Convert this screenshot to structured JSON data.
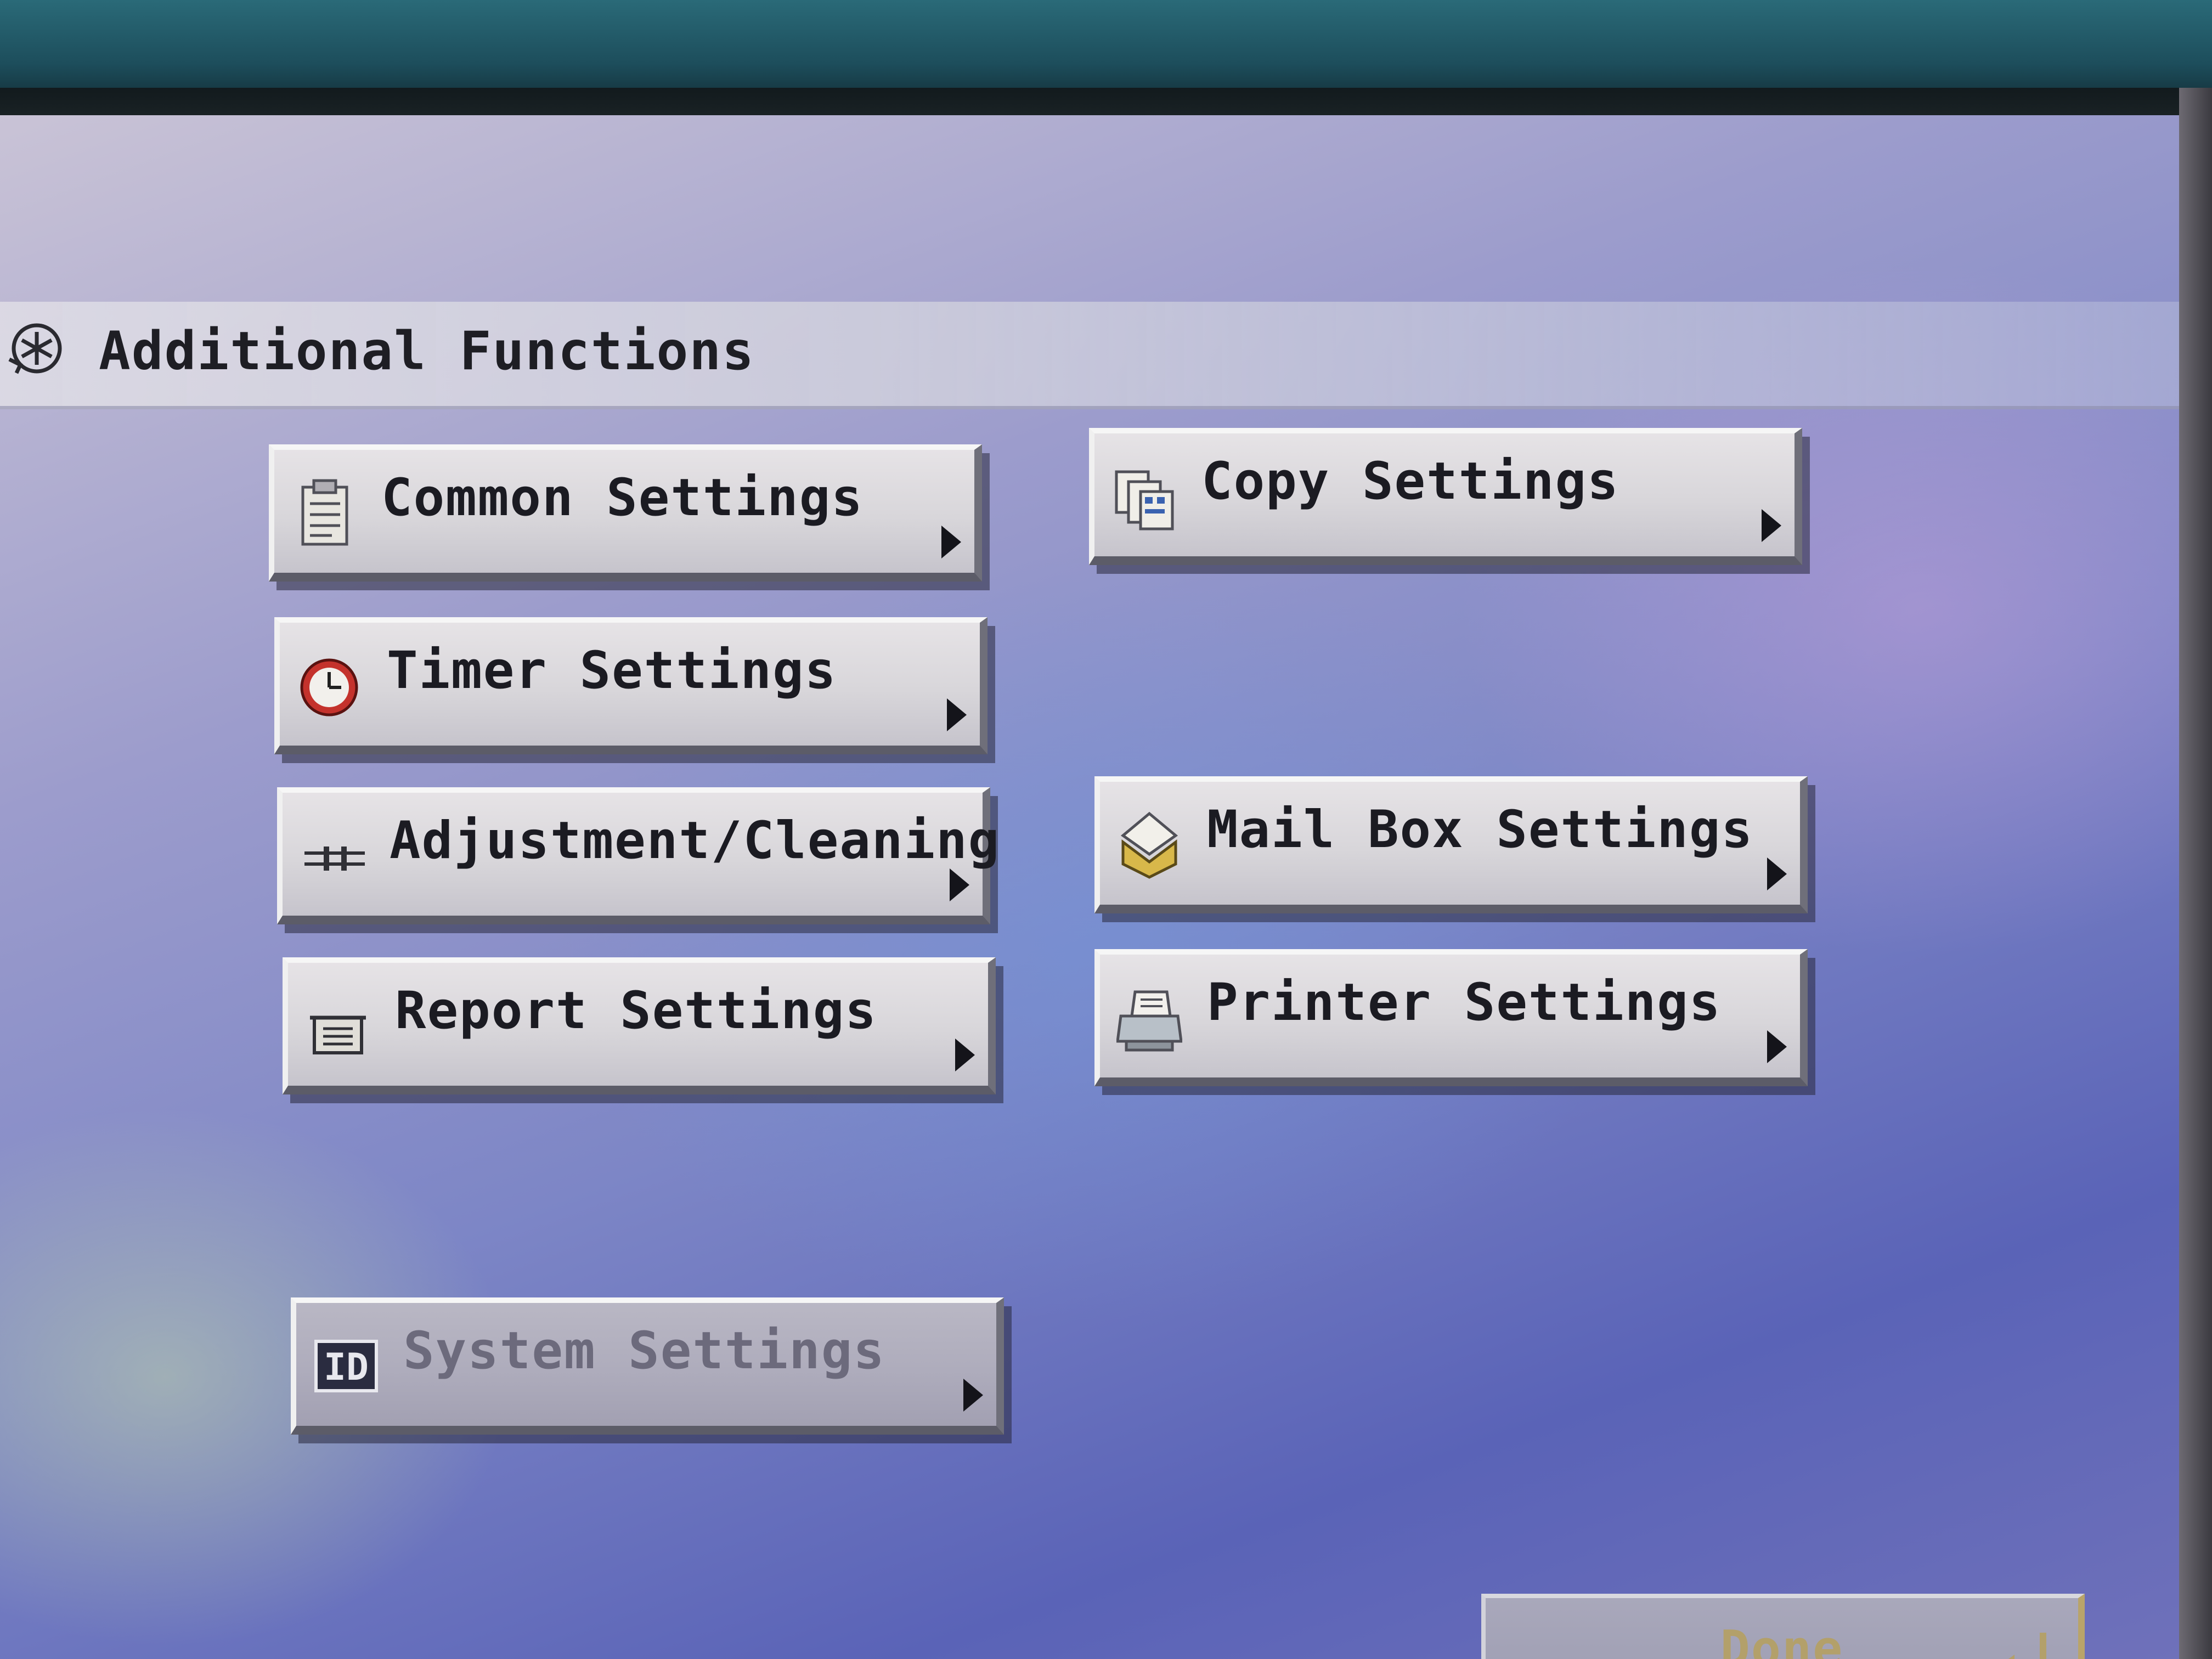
{
  "header": {
    "title": "Additional Functions",
    "icon": "additional-functions-icon"
  },
  "buttons": {
    "common_settings": {
      "label": "Common Settings",
      "icon": "clipboard-icon"
    },
    "copy_settings": {
      "label": "Copy Settings",
      "icon": "copy-pages-icon"
    },
    "timer_settings": {
      "label": "Timer Settings",
      "icon": "clock-icon"
    },
    "adjustment_cleaning": {
      "label": "Adjustment/Cleaning",
      "icon": "slider-adjust-icon"
    },
    "mail_box_settings": {
      "label": "Mail Box Settings",
      "icon": "mailbox-icon"
    },
    "report_settings": {
      "label": "Report Settings",
      "icon": "report-icon"
    },
    "printer_settings": {
      "label": "Printer Settings",
      "icon": "printer-icon"
    },
    "system_settings": {
      "label": "System Settings",
      "icon": "id-icon",
      "badge": "ID",
      "disabled": true
    }
  },
  "footer": {
    "done_label": "Done",
    "done_icon": "enter-arrow-icon",
    "done_disabled": true
  },
  "colors": {
    "button_face": "#d8d6da",
    "button_text": "#1b1b22",
    "disabled_text": "#6c6a7c",
    "done_text": "#b3a06a",
    "clock_red": "#c4322c"
  }
}
